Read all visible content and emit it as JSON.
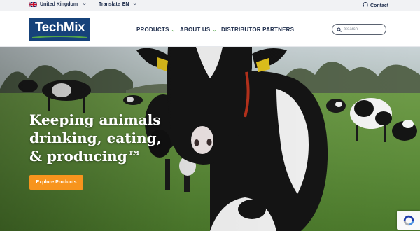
{
  "topbar": {
    "region": "United Kingdom",
    "region_flag_icon": "uk-flag-icon",
    "translate": "Translate",
    "language": "EN",
    "contact": "Contact",
    "contact_icon": "headset-icon"
  },
  "header": {
    "logo": "TechMix",
    "nav": [
      {
        "label": "PRODUCTS",
        "has_dropdown": true
      },
      {
        "label": "ABOUT US",
        "has_dropdown": true
      },
      {
        "label": "DISTRIBUTOR PARTNERS",
        "has_dropdown": false
      }
    ],
    "search_placeholder": "Search"
  },
  "hero": {
    "headline_lines": [
      "Keeping animals",
      "drinking, eating,",
      "& producing™"
    ],
    "cta_label": "Explore Products"
  },
  "colors": {
    "brand_navy": "#16427a",
    "nav_text": "#1c2b4a",
    "accent_green": "#53a548",
    "cta_orange": "#f7941d",
    "topbar_bg": "#f1f2f4"
  }
}
